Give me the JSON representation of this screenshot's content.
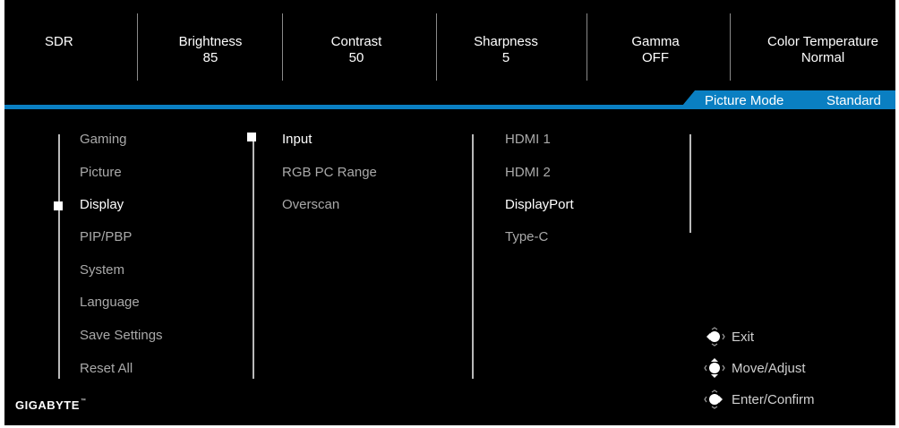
{
  "status": {
    "sdr": {
      "label": "SDR"
    },
    "brightness": {
      "label": "Brightness",
      "value": "85"
    },
    "contrast": {
      "label": "Contrast",
      "value": "50"
    },
    "sharpness": {
      "label": "Sharpness",
      "value": "5"
    },
    "gamma": {
      "label": "Gamma",
      "value": "OFF"
    },
    "color_temperature": {
      "label": "Color Temperature",
      "value": "Normal"
    }
  },
  "picture_mode": {
    "label": "Picture Mode",
    "value": "Standard"
  },
  "menu": {
    "items": [
      "Gaming",
      "Picture",
      "Display",
      "PIP/PBP",
      "System",
      "Language",
      "Save Settings",
      "Reset All"
    ],
    "selected": "Display"
  },
  "submenu": {
    "items": [
      "Input",
      "RGB PC Range",
      "Overscan"
    ],
    "selected": "Input"
  },
  "options": {
    "items": [
      "HDMI 1",
      "HDMI 2",
      "DisplayPort",
      "Type-C"
    ],
    "selected": "DisplayPort"
  },
  "hints": [
    {
      "label": "Exit",
      "icon": "joystick-left-icon"
    },
    {
      "label": "Move/Adjust",
      "icon": "joystick-up-down-icon"
    },
    {
      "label": "Enter/Confirm",
      "icon": "joystick-right-icon"
    }
  ],
  "brand": {
    "name": "GIGABYTE",
    "mark": "™"
  },
  "colors": {
    "background": "#000000",
    "accent": "#0a7fc2",
    "text": "#ffffff",
    "inactive_text": "#a9a9a9"
  }
}
